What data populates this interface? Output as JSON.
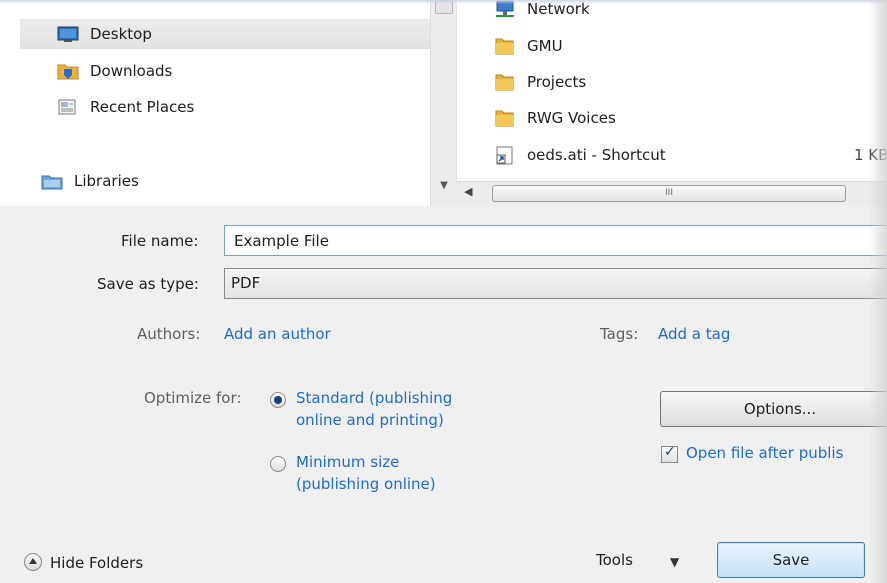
{
  "nav": {
    "items": [
      {
        "label": "Desktop",
        "icon": "desktop-icon",
        "selected": true
      },
      {
        "label": "Downloads",
        "icon": "downloads-folder-icon",
        "selected": false
      },
      {
        "label": "Recent Places",
        "icon": "recent-places-icon",
        "selected": false
      },
      {
        "label": "Libraries",
        "icon": "libraries-icon",
        "selected": false
      }
    ]
  },
  "files": {
    "items": [
      {
        "label": "Network",
        "icon": "network-icon",
        "size": ""
      },
      {
        "label": "GMU",
        "icon": "folder-icon",
        "size": ""
      },
      {
        "label": "Projects",
        "icon": "folder-icon",
        "size": ""
      },
      {
        "label": "RWG Voices",
        "icon": "folder-icon",
        "size": ""
      },
      {
        "label": "oeds.ati - Shortcut",
        "icon": "shortcut-icon",
        "size": "1 KB"
      }
    ],
    "scroll_grip": "III"
  },
  "form": {
    "file_name_label": "File name:",
    "file_name_value": "Example File",
    "save_type_label": "Save as type:",
    "save_type_value": "PDF",
    "authors_label": "Authors:",
    "authors_link": "Add an author",
    "tags_label": "Tags:",
    "tags_link": "Add a tag",
    "optimize_label": "Optimize for:",
    "optimize_options": [
      {
        "line1": "Standard (publishing",
        "line2": "online and printing)",
        "checked": true
      },
      {
        "line1": "Minimum size",
        "line2": "(publishing online)",
        "checked": false
      }
    ],
    "options_button": "Options...",
    "open_after_label": "Open file after publis",
    "open_after_checked": true
  },
  "footer": {
    "hide_folders_label": "Hide Folders",
    "tools_label": "Tools",
    "save_button": "Save"
  },
  "colors": {
    "link": "#1f6cc7",
    "folder": "#e8b23c",
    "selected_bg": "#e6e6e6"
  }
}
